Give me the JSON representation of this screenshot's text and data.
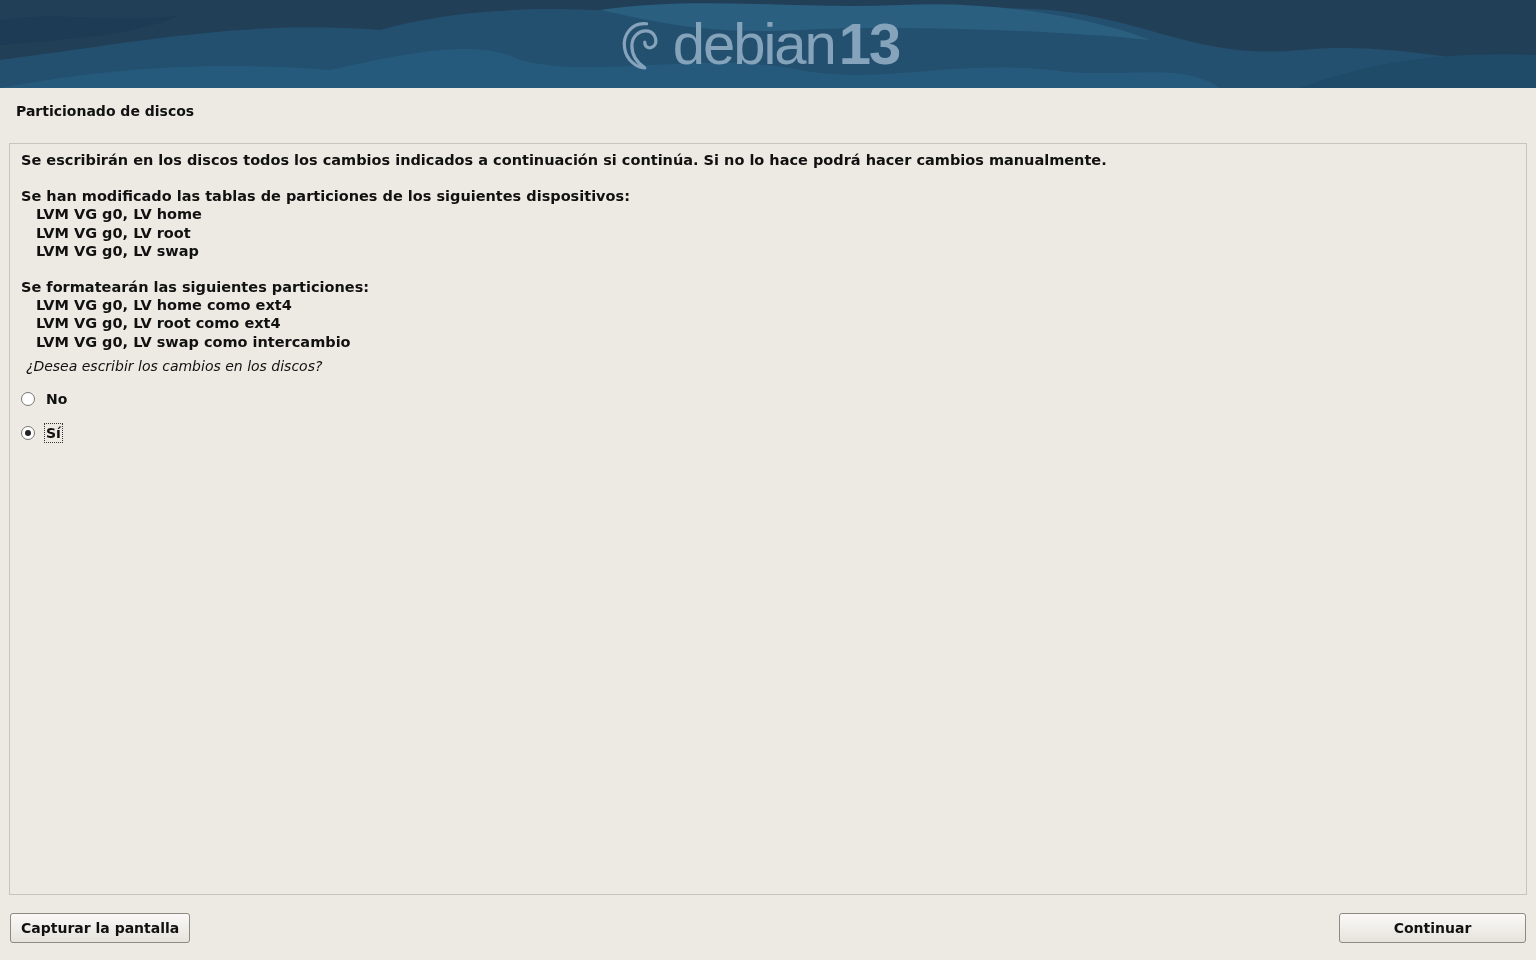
{
  "banner": {
    "logo_text": "debian",
    "version": "13"
  },
  "title": "Particionado de discos",
  "intro": "Se escribirán en los discos todos los cambios indicados a continuación si continúa. Si no lo hace podrá hacer cambios manualmente.",
  "sections": [
    {
      "heading": "Se han modificado las tablas de particiones de los siguientes dispositivos:",
      "items": [
        "LVM VG g0, LV home",
        "LVM VG g0, LV root",
        "LVM VG g0, LV swap"
      ]
    },
    {
      "heading": "Se formatearán las siguientes particiones:",
      "items": [
        "LVM VG g0, LV home como ext4",
        "LVM VG g0, LV root como ext4",
        "LVM VG g0, LV swap como intercambio"
      ]
    }
  ],
  "question": "¿Desea escribir los cambios en los discos?",
  "options": [
    {
      "label": "No",
      "selected": false,
      "focused": false
    },
    {
      "label": "Sí",
      "selected": true,
      "focused": true
    }
  ],
  "buttons": {
    "left": "Capturar la pantalla",
    "right": "Continuar"
  }
}
